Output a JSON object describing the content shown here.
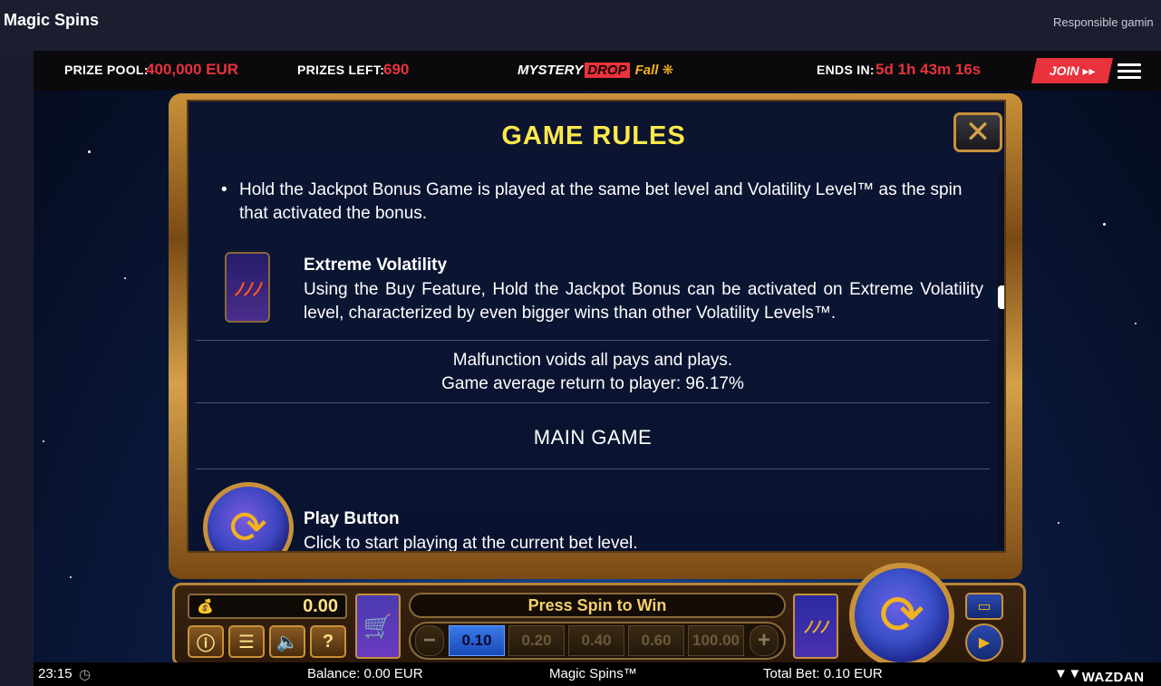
{
  "site": {
    "brand": "Magic Spins",
    "responsible": "Responsible gamin"
  },
  "promo": {
    "prize_pool_label": "PRIZE POOL:",
    "prize_pool_value": "400,000 EUR",
    "prizes_left_label": "PRIZES LEFT:",
    "prizes_left_value": "690",
    "logo_mystery": "MYSTERY",
    "logo_drop": "DROP",
    "logo_fall": "Fall",
    "ends_label": "ENDS IN:",
    "ends_value": "5d 1h 43m 16s",
    "join_label": "JOIN ▸▸",
    "menu_icon": "hamburger-icon"
  },
  "rules": {
    "title": "GAME RULES",
    "close_icon": "close-icon",
    "bullet_text": "Hold the Jackpot Bonus Game is played at the same bet level and Volatility Level™ as the spin that activated the bonus.",
    "extreme_heading": "Extreme Volatility",
    "extreme_text": "Using the Buy Feature, Hold the Jackpot Bonus can be activated on Extreme Volatility level, characterized by even bigger wins than other Volatility Levels™.",
    "malfunction": "Malfunction voids all pays and plays.",
    "rtp": "Game average return to player: 96.17%",
    "main_game": "MAIN GAME",
    "play_heading": "Play Button",
    "play_text": "Click to start playing at the current bet level."
  },
  "controls": {
    "balance_amount": "0.00",
    "bag_icon": "money-bag-icon",
    "message": "Press Spin to Win",
    "bet_options": [
      "0.10",
      "0.20",
      "0.40",
      "0.60",
      "100.00"
    ],
    "selected_bet": "0.10",
    "minus": "−",
    "plus": "+",
    "info_icon": "info-icon",
    "menu_icon": "menu-icon",
    "sound_icon": "sound-icon",
    "help_label": "?"
  },
  "status": {
    "time": "23:15",
    "balance": "Balance: 0.00 EUR",
    "game_name": "Magic Spins™",
    "total_bet": "Total Bet: 0.10 EUR",
    "provider": "WAZDAN"
  },
  "colors": {
    "accent_red": "#e8323c",
    "gold": "#c8913a",
    "title_yellow": "#ffe94a"
  }
}
